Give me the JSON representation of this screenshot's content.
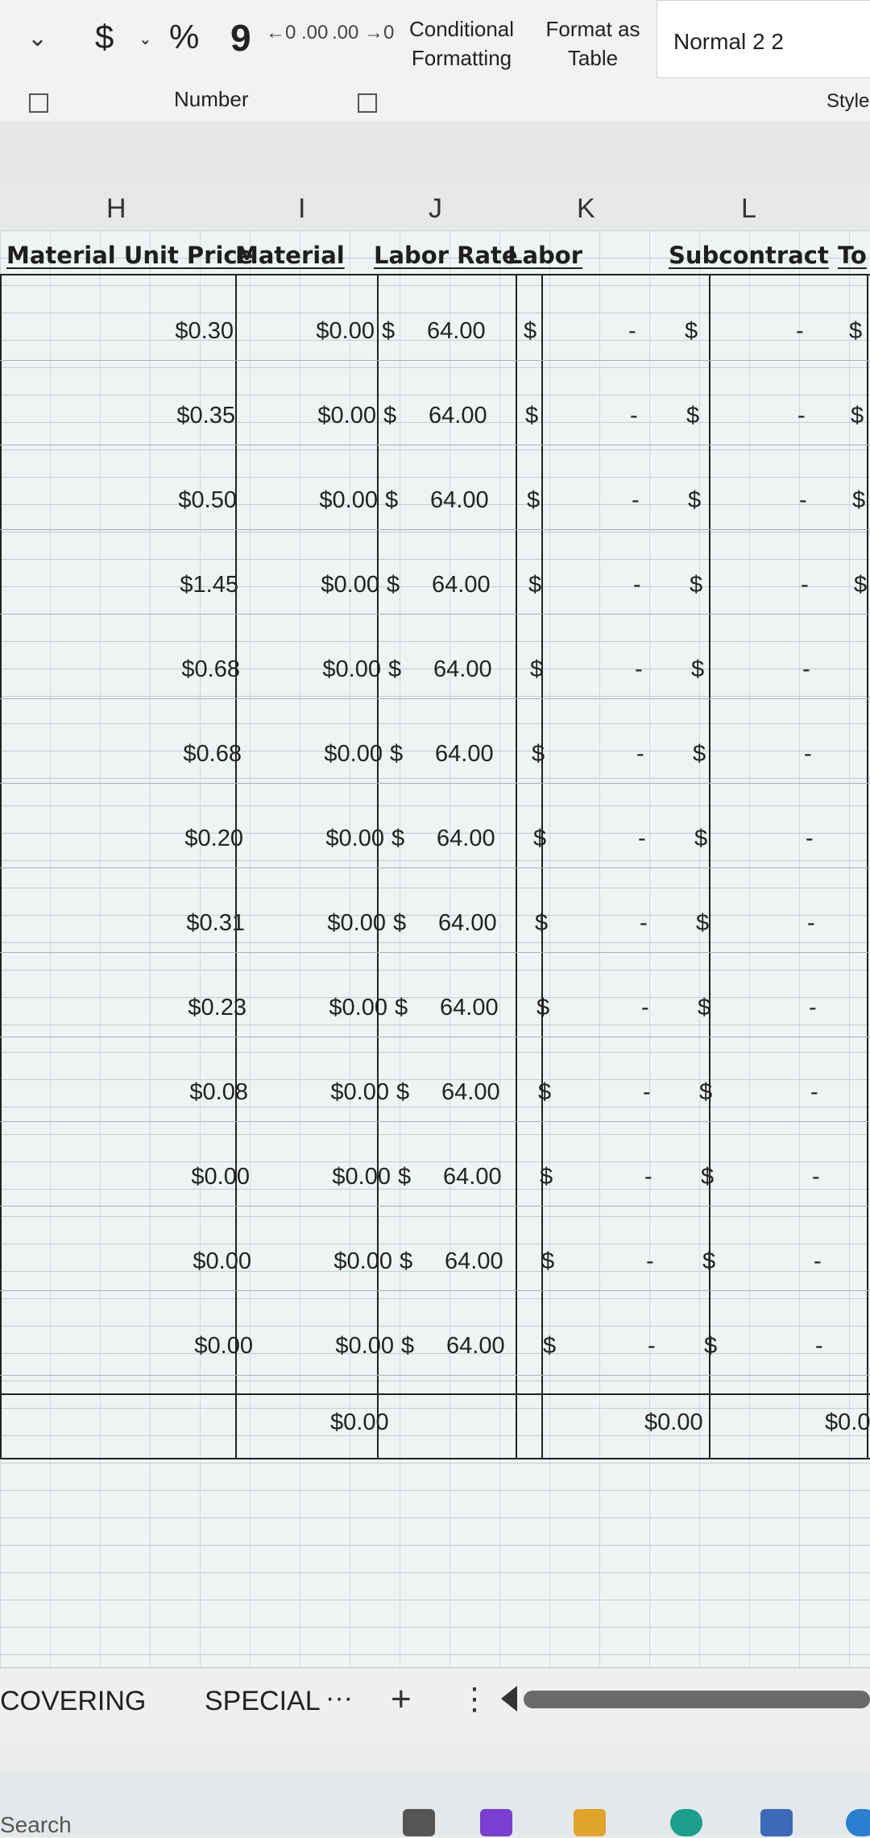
{
  "ribbon": {
    "currency_symbol": "$",
    "percent_symbol": "%",
    "comma_symbol": "9",
    "increase_decimal_label": "←0 .00",
    "decrease_decimal_label": ".00 →0",
    "conditional_formatting": "Conditional Formatting",
    "format_as_table": "Format as Table",
    "cell_style": "Normal 2 2",
    "number_group_label": "Number",
    "styles_group_label": "Style"
  },
  "columns": [
    "H",
    "I",
    "J",
    "K",
    "L"
  ],
  "headers": {
    "material_unit_price": "Material Unit Price",
    "material": "Material",
    "labor_rate": "Labor Rate",
    "labor": "Labor",
    "subcontract": "Subcontract",
    "total": "To"
  },
  "rows": [
    {
      "unit_price": "$0.30",
      "material": "$0.00",
      "rate_cur": "$",
      "labor_rate": "64.00",
      "labor_cur": "$",
      "labor": "-",
      "sub_cur": "$",
      "sub": "-",
      "tot_cur": "$"
    },
    {
      "unit_price": "$0.35",
      "material": "$0.00",
      "rate_cur": "$",
      "labor_rate": "64.00",
      "labor_cur": "$",
      "labor": "-",
      "sub_cur": "$",
      "sub": "-",
      "tot_cur": "$"
    },
    {
      "unit_price": "$0.50",
      "material": "$0.00",
      "rate_cur": "$",
      "labor_rate": "64.00",
      "labor_cur": "$",
      "labor": "-",
      "sub_cur": "$",
      "sub": "-",
      "tot_cur": "$"
    },
    {
      "unit_price": "$1.45",
      "material": "$0.00",
      "rate_cur": "$",
      "labor_rate": "64.00",
      "labor_cur": "$",
      "labor": "-",
      "sub_cur": "$",
      "sub": "-",
      "tot_cur": "$"
    },
    {
      "unit_price": "$0.68",
      "material": "$0.00",
      "rate_cur": "$",
      "labor_rate": "64.00",
      "labor_cur": "$",
      "labor": "-",
      "sub_cur": "$",
      "sub": "-",
      "tot_cur": ""
    },
    {
      "unit_price": "$0.68",
      "material": "$0.00",
      "rate_cur": "$",
      "labor_rate": "64.00",
      "labor_cur": "$",
      "labor": "-",
      "sub_cur": "$",
      "sub": "-",
      "tot_cur": ""
    },
    {
      "unit_price": "$0.20",
      "material": "$0.00",
      "rate_cur": "$",
      "labor_rate": "64.00",
      "labor_cur": "$",
      "labor": "-",
      "sub_cur": "$",
      "sub": "-",
      "tot_cur": ""
    },
    {
      "unit_price": "$0.31",
      "material": "$0.00",
      "rate_cur": "$",
      "labor_rate": "64.00",
      "labor_cur": "$",
      "labor": "-",
      "sub_cur": "$",
      "sub": "-",
      "tot_cur": ""
    },
    {
      "unit_price": "$0.23",
      "material": "$0.00",
      "rate_cur": "$",
      "labor_rate": "64.00",
      "labor_cur": "$",
      "labor": "-",
      "sub_cur": "$",
      "sub": "-",
      "tot_cur": ""
    },
    {
      "unit_price": "$0.08",
      "material": "$0.00",
      "rate_cur": "$",
      "labor_rate": "64.00",
      "labor_cur": "$",
      "labor": "-",
      "sub_cur": "$",
      "sub": "-",
      "tot_cur": ""
    },
    {
      "unit_price": "$0.00",
      "material": "$0.00",
      "rate_cur": "$",
      "labor_rate": "64.00",
      "labor_cur": "$",
      "labor": "-",
      "sub_cur": "$",
      "sub": "-",
      "tot_cur": ""
    },
    {
      "unit_price": "$0.00",
      "material": "$0.00",
      "rate_cur": "$",
      "labor_rate": "64.00",
      "labor_cur": "$",
      "labor": "-",
      "sub_cur": "$",
      "sub": "-",
      "tot_cur": ""
    },
    {
      "unit_price": "$0.00",
      "material": "$0.00",
      "rate_cur": "$",
      "labor_rate": "64.00",
      "labor_cur": "$",
      "labor": "-",
      "sub_cur": "$",
      "sub": "-",
      "tot_cur": ""
    }
  ],
  "totals": {
    "material": "$0.00",
    "subcontract": "$0.00",
    "total": "$0.0"
  },
  "sheet_tabs": [
    "COVERING",
    "SPECIAL"
  ],
  "sheet_tab_overflow": "···",
  "add_sheet": "+",
  "more_options": "⋮",
  "taskbar": {
    "search_label": "Search"
  },
  "colors": {
    "grid_bg": "#eef3f3",
    "border": "#222222"
  }
}
